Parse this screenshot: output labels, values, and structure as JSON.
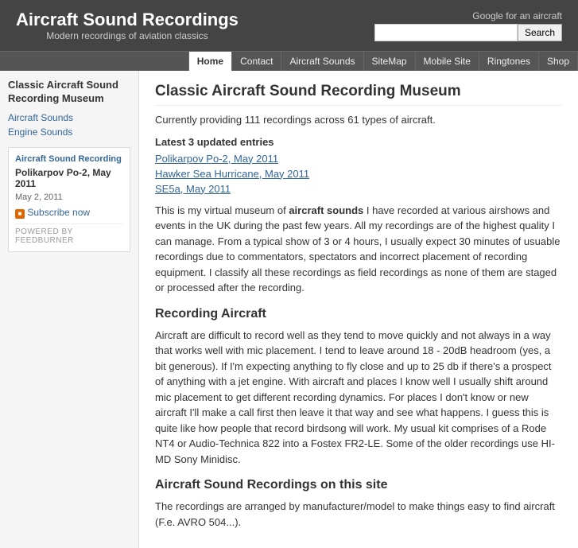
{
  "header": {
    "title": "Aircraft Sound Recordings",
    "subtitle": "Modern recordings of aviation classics",
    "search_label": "Google for an aircraft",
    "search_placeholder": "",
    "search_button": "Search"
  },
  "nav": {
    "items": [
      {
        "label": "Home",
        "active": true
      },
      {
        "label": "Contact",
        "active": false
      },
      {
        "label": "Aircraft Sounds",
        "active": false
      },
      {
        "label": "SiteMap",
        "active": false
      },
      {
        "label": "Mobile Site",
        "active": false
      },
      {
        "label": "Ringtones",
        "active": false
      },
      {
        "label": "Shop",
        "active": false
      }
    ]
  },
  "sidebar": {
    "heading": "Classic Aircraft Sound Recording Museum",
    "links": [
      {
        "label": "Aircraft Sounds"
      },
      {
        "label": "Engine Sounds"
      }
    ],
    "widget": {
      "title": "Aircraft Sound Recording",
      "post_title": "Polikarpov Po-2, May 2011",
      "date": "May 2, 2011",
      "subscribe_label": "Subscribe now",
      "powered_by": "POWERED BY FEEDBURNER"
    }
  },
  "main": {
    "page_title": "Classic Aircraft Sound Recording Museum",
    "intro": "Currently providing 111 recordings across 61 types of aircraft.",
    "latest_heading": "Latest 3 updated entries",
    "entries": [
      {
        "label": "Polikarpov Po-2, May 2011"
      },
      {
        "label": "Hawker Sea Hurricane, May 2011"
      },
      {
        "label": "SE5a, May 2011"
      }
    ],
    "body_paragraphs": [
      "This is my virtual museum of aircraft sounds I have recorded at various airshows and events in the UK during the past few years. All my recordings are of the highest quality I can manage. From a typical show of 3 or 4 hours, I usually expect 30 minutes of usuable recordings due to commentators, spectators and incorrect placement of recording equipment. I classify all these recordings as field recordings as none of them are staged or processed after the recording.",
      ""
    ],
    "recording_aircraft_heading": "Recording Aircraft",
    "recording_aircraft_body": "Aircraft are difficult to record well as they tend to move quickly and not always in a way that works well with mic placement. I tend to leave around 18 - 20dB headroom (yes, a bit generous). If I'm expecting anything to fly close and up to 25 db if there's a prospect of anything with a jet engine. With aircraft and places I know well I usually shift around mic placement to get different recording dynamics. For places I don't know or new aircraft I'll make a call first then leave it that way and see what happens. I guess this is quite like how people that record birdsong will work. My usual kit comprises of a Rode NT4 or Audio-Technica 822 into a Fostex FR2-LE. Some of the older recordings use HI-MD Sony Minidisc.",
    "site_heading": "Aircraft Sound Recordings on this site",
    "site_body": "The recordings are arranged by manufacturer/model to make things easy to find aircraft (F.e. AVRO 504...)."
  }
}
